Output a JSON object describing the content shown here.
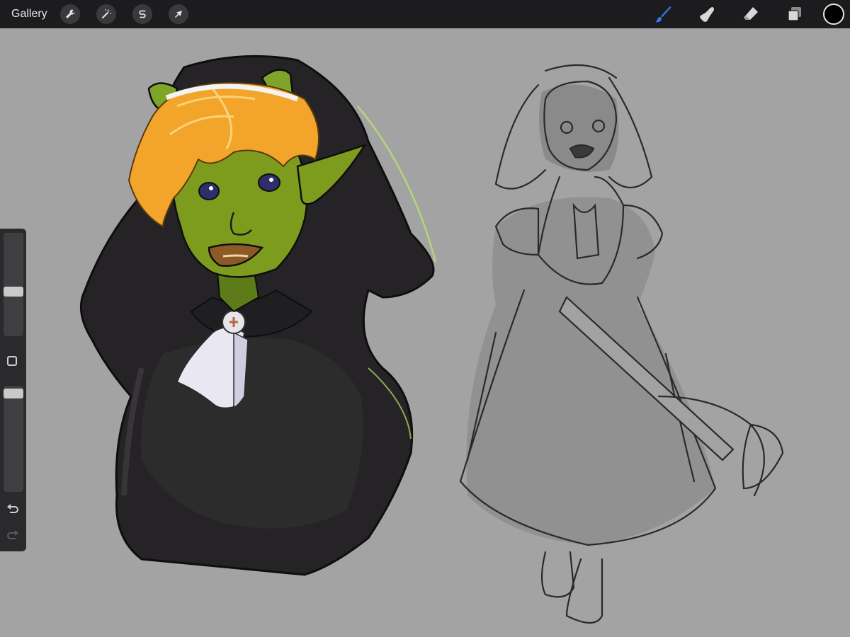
{
  "toolbar": {
    "gallery_label": "Gallery",
    "left_tools": [
      {
        "name": "actions",
        "icon": "wrench-icon"
      },
      {
        "name": "adjustments",
        "icon": "magic-wand-icon"
      },
      {
        "name": "selection",
        "icon": "selection-s-icon"
      },
      {
        "name": "transform",
        "icon": "arrow-cursor-icon"
      }
    ],
    "right_tools": [
      {
        "name": "brush",
        "icon": "brush-icon",
        "active": true
      },
      {
        "name": "smudge",
        "icon": "smudge-finger-icon",
        "active": false
      },
      {
        "name": "eraser",
        "icon": "eraser-icon",
        "active": false
      },
      {
        "name": "layers",
        "icon": "layers-icon",
        "active": false
      }
    ],
    "current_color": "#000000",
    "active_color": "#2f7df6"
  },
  "sidebar": {
    "brush_size_level": 0.48,
    "opacity_level": 0.95
  },
  "canvas": {
    "background": "#a3a3a3",
    "artwork": [
      "colored-goblin-nun-portrait",
      "pencil-sketch-full-body-figure"
    ]
  }
}
